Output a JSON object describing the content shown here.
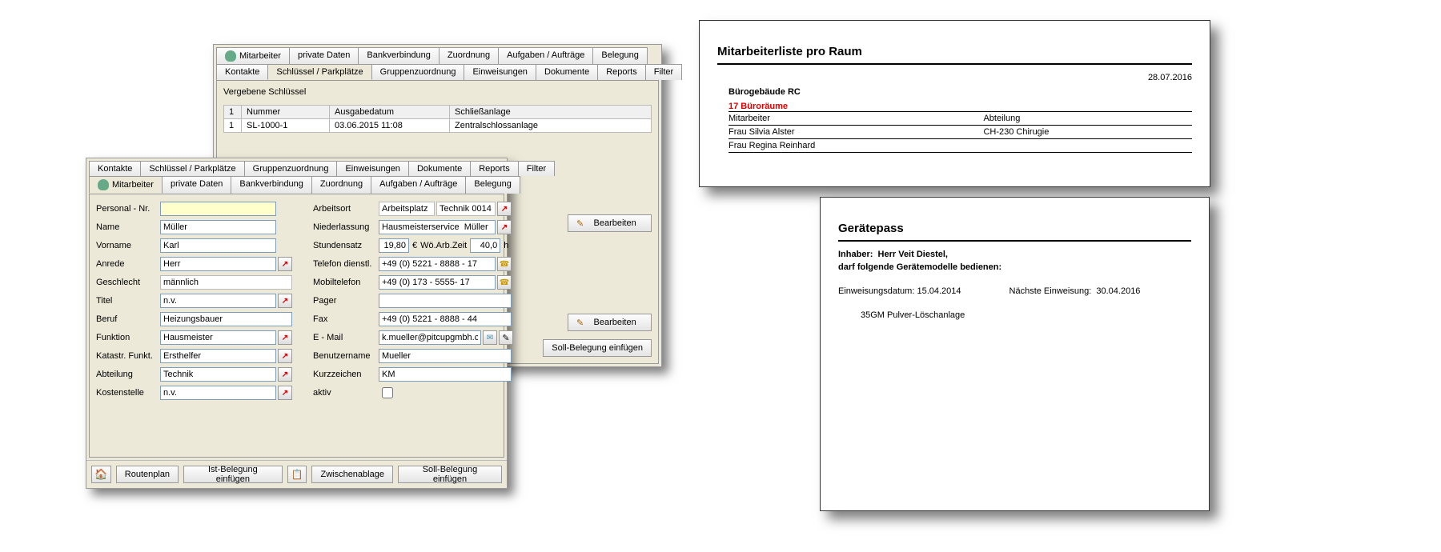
{
  "backDialog": {
    "tabsTop": [
      "Mitarbeiter",
      "private Daten",
      "Bankverbindung",
      "Zuordnung",
      "Aufgaben / Aufträge",
      "Belegung"
    ],
    "tabsBottom": [
      "Kontakte",
      "Schlüssel / Parkplätze",
      "Gruppenzuordnung",
      "Einweisungen",
      "Dokumente",
      "Reports",
      "Filter"
    ],
    "activeTab": "Schlüssel / Parkplätze",
    "sectionTitle": "Vergebene Schlüssel",
    "grid": {
      "headers": [
        "1",
        "Nummer",
        "Ausgabedatum",
        "Schließanlage"
      ],
      "row": [
        "1",
        "SL-1000-1",
        "03.06.2015 11:08",
        "Zentralschlossanlage"
      ]
    },
    "editBtn": "Bearbeiten",
    "editBtn2": "Bearbeiten",
    "sollBtn": "Soll-Belegung einfügen"
  },
  "frontDialog": {
    "tabsTop": [
      "Kontakte",
      "Schlüssel / Parkplätze",
      "Gruppenzuordnung",
      "Einweisungen",
      "Dokumente",
      "Reports",
      "Filter"
    ],
    "tabsBottom": [
      "Mitarbeiter",
      "private Daten",
      "Bankverbindung",
      "Zuordnung",
      "Aufgaben / Aufträge",
      "Belegung"
    ],
    "activeTab": "Mitarbeiter",
    "left": {
      "personalNr": {
        "label": "Personal - Nr.",
        "value": ""
      },
      "name": {
        "label": "Name",
        "value": "Müller"
      },
      "vorname": {
        "label": "Vorname",
        "value": "Karl"
      },
      "anrede": {
        "label": "Anrede",
        "value": "Herr"
      },
      "geschlecht": {
        "label": "Geschlecht",
        "value": "männlich"
      },
      "titel": {
        "label": "Titel",
        "value": "n.v."
      },
      "beruf": {
        "label": "Beruf",
        "value": "Heizungsbauer"
      },
      "funktion": {
        "label": "Funktion",
        "value": "Hausmeister"
      },
      "katastr": {
        "label": "Katastr. Funkt.",
        "value": "Ersthelfer"
      },
      "abteilung": {
        "label": "Abteilung",
        "value": "Technik"
      },
      "kostenstelle": {
        "label": "Kostenstelle",
        "value": "n.v."
      }
    },
    "right": {
      "arbeitsort": {
        "label": "Arbeitsort",
        "value": "Arbeitsplatz",
        "extra": "Technik 0014"
      },
      "niederlassung": {
        "label": "Niederlassung",
        "value": "Hausmeisterservice  Müller"
      },
      "stundensatz": {
        "label": "Stundensatz",
        "value": "19,80",
        "unit": "€",
        "woLabel": "Wö.Arb.Zeit",
        "woValue": "40,0",
        "woUnit": "h"
      },
      "telefon": {
        "label": "Telefon dienstl.",
        "value": "+49 (0) 5221 - 8888 - 17"
      },
      "mobil": {
        "label": "Mobiltelefon",
        "value": "+49 (0) 173 - 5555- 17"
      },
      "pager": {
        "label": "Pager",
        "value": ""
      },
      "fax": {
        "label": "Fax",
        "value": "+49 (0) 5221 - 8888 - 44"
      },
      "email": {
        "label": "E - Mail",
        "value": "k.mueller@pitcupgmbh.com"
      },
      "benutzer": {
        "label": "Benutzername",
        "value": "Mueller"
      },
      "kurz": {
        "label": "Kurzzeichen",
        "value": "KM"
      },
      "aktiv": {
        "label": "aktiv",
        "checked": false
      }
    },
    "bottomButtons": {
      "routenplan": "Routenplan",
      "istBelegung": "Ist-Belegung einfügen",
      "zwischenablage": "Zwischenablage",
      "sollBelegung": "Soll-Belegung einfügen"
    }
  },
  "report1": {
    "title": "Mitarbeiterliste pro Raum",
    "date": "28.07.2016",
    "building": "Bürogebäude RC",
    "rooms": "17 Büroräume",
    "headers": [
      "Mitarbeiter",
      "Abteilung"
    ],
    "rows": [
      [
        "Frau Silvia Alster",
        "CH-230 Chirugie"
      ],
      [
        "Frau Regina Reinhard",
        ""
      ]
    ]
  },
  "report2": {
    "title": "Gerätepass",
    "inhaberLabel": "Inhaber:",
    "inhaber": "Herr Veit Diestel,",
    "subline": "darf folgende Gerätemodelle bedienen:",
    "einwDatumLabel": "Einweisungsdatum:",
    "einwDatum": "15.04.2014",
    "nextLabel": "Nächste Einweisung:",
    "nextDate": "30.04.2016",
    "item": "35GM Pulver-Löschanlage"
  }
}
